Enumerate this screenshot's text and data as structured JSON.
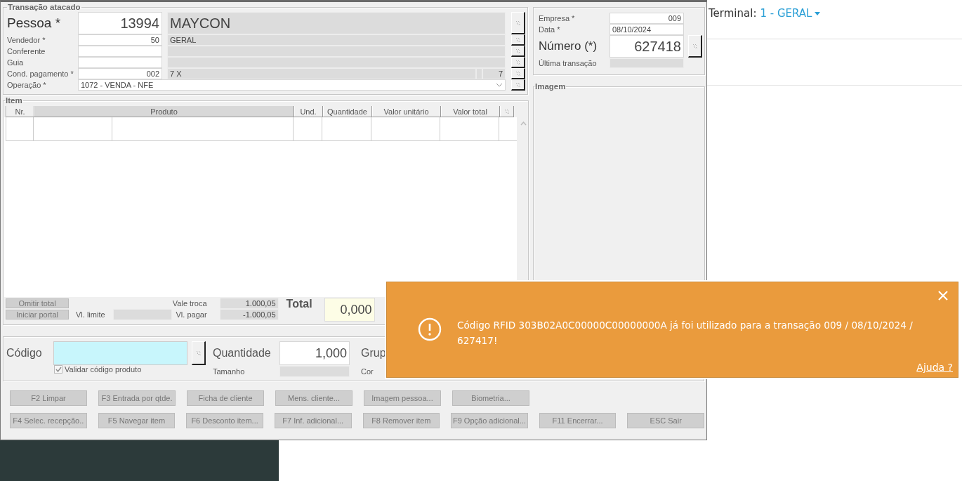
{
  "terminal": {
    "label": "Terminal:",
    "value": "1 - GERAL"
  },
  "transacao": {
    "title": "Transação atacado",
    "fields": [
      {
        "label": "Pessoa *",
        "code": "13994",
        "name": "MAYCON",
        "kind": "big"
      },
      {
        "label": "Vendedor *",
        "code": "50",
        "name": "GERAL",
        "kind": "normal"
      },
      {
        "label": "Conferente",
        "kind": "normal"
      },
      {
        "label": "Guia",
        "kind": "normal"
      },
      {
        "label": "Cond. pagamento *",
        "code": "002",
        "name": "7 X",
        "extra": "7",
        "kind": "split"
      }
    ],
    "operacao": {
      "label": "Operação *",
      "value": "1072 - VENDA - NFE"
    }
  },
  "documento": {
    "empresa": {
      "label": "Empresa *",
      "value": "009"
    },
    "data": {
      "label": "Data *",
      "value": "08/10/2024"
    },
    "numero": {
      "label": "Número (*)",
      "value": "627418"
    },
    "ultima": {
      "label": "Última transação"
    }
  },
  "imagem": {
    "title": "Imagem"
  },
  "item": {
    "title": "Item",
    "columns": [
      {
        "label": "Nr.",
        "selected": false
      },
      {
        "label": "Produto",
        "selected": true
      },
      {
        "label": "Und.",
        "selected": false
      },
      {
        "label": "Quantidade",
        "selected": false
      },
      {
        "label": "Valor unitário",
        "selected": false
      },
      {
        "label": "Valor total",
        "selected": false
      }
    ]
  },
  "totals": {
    "buttons": [
      "Omitir total",
      "Iniciar portal"
    ],
    "vl_limite": {
      "label": "Vl. limite"
    },
    "vale_troca": {
      "label": "Vale troca",
      "value": "1.000,05"
    },
    "vl_pagar": {
      "label": "Vl. pagar",
      "value": "-1.000,05"
    },
    "total": {
      "label": "Total",
      "value": "0,000"
    }
  },
  "entrada": {
    "codigo": {
      "label": "Código"
    },
    "validar": {
      "label": "Validar código produto",
      "checked": true
    },
    "quantidade": {
      "label": "Quantidade",
      "value": "1,000"
    },
    "tamanho": {
      "label": "Tamanho"
    },
    "grupo": {
      "label": "Grup"
    },
    "cor": {
      "label": "Cor"
    }
  },
  "function_buttons": [
    [
      "F2 Limpar",
      "F3 Entrada por qtde.",
      "Ficha de cliente",
      "Mens. cliente...",
      "Imagem pessoa...",
      "Biometria..."
    ],
    [
      "F4 Selec. recepção..",
      "F5 Navegar item",
      "F6 Desconto item...",
      "F7 Inf. adicional...",
      "F8 Remover item",
      "F9 Opção adicional...",
      "F11 Encerrar...",
      "ESC Sair"
    ]
  ],
  "toast": {
    "message": "Código RFID 303B02A0C00000C00000000A já foi utilizado para a transação 009 / 08/10/2024 / 627417!",
    "help": "Ajuda ?"
  }
}
